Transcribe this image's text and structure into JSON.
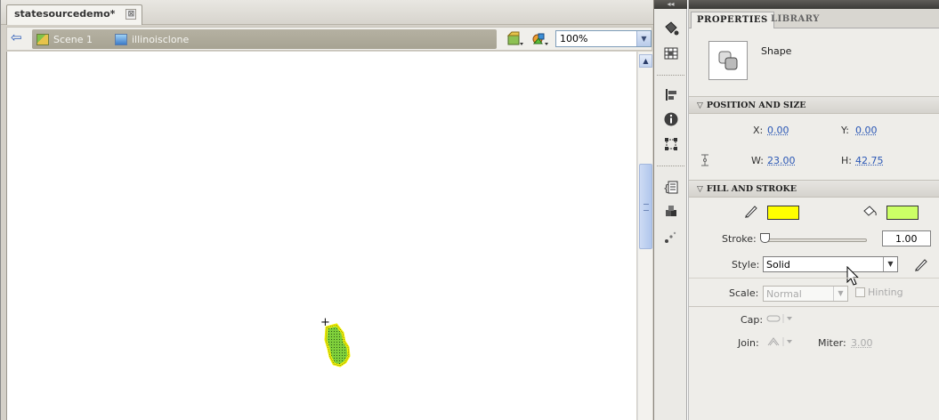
{
  "document": {
    "tab_title": "statesourcedemo*",
    "tab_close": "⊠",
    "breadcrumbs": [
      {
        "label": "Scene 1",
        "icon": "scene-icon"
      },
      {
        "label": "illinoisclone",
        "icon": "movieclip-symbol-icon"
      }
    ],
    "zoom": "100%",
    "shape_colors": {
      "stroke": "#ffff00",
      "fill": "#66cc33"
    }
  },
  "dock": {
    "collapse_label": "◂◂",
    "icons": [
      "paint-bucket-icon",
      "swatches-icon",
      "align-icon",
      "info-icon",
      "transform-icon",
      "actions-icon",
      "components-icon",
      "motion-presets-icon"
    ]
  },
  "panel": {
    "tabs": [
      {
        "label": "PROPERTIES",
        "active": true
      },
      {
        "label": "LIBRARY",
        "active": false
      }
    ],
    "object_type": "Shape",
    "sections": {
      "position_size": "POSITION AND SIZE",
      "fill_stroke": "FILL AND STROKE"
    },
    "position": {
      "x_label": "X:",
      "x_value": "0.00",
      "y_label": "Y:",
      "y_value": "0.00",
      "w_label": "W:",
      "w_value": "23.00",
      "h_label": "H:",
      "h_value": "42.75"
    },
    "fill_stroke": {
      "stroke_color": "#ffff00",
      "fill_color": "#ccff66",
      "stroke_label": "Stroke:",
      "stroke_value": "1.00",
      "style_label": "Style:",
      "style_value": "Solid",
      "scale_label": "Scale:",
      "scale_value": "Normal",
      "hinting_label": "Hinting",
      "cap_label": "Cap:",
      "join_label": "Join:",
      "miter_label": "Miter:",
      "miter_value": "3.00"
    }
  }
}
